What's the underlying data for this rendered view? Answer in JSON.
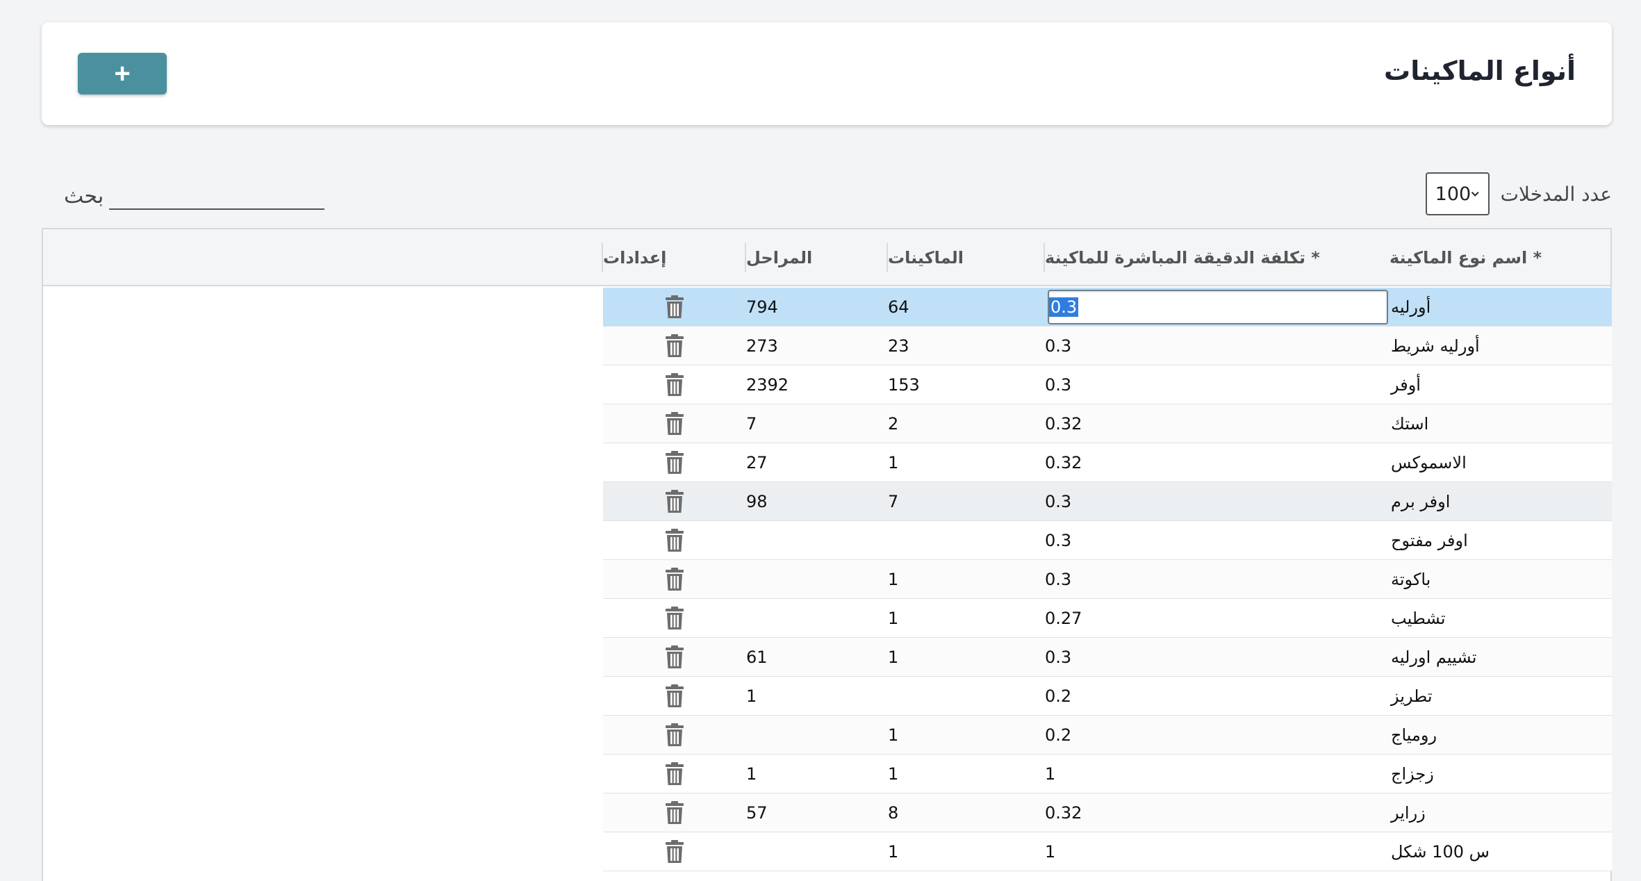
{
  "header": {
    "title": "أنواع الماكينات",
    "add_label": "+"
  },
  "controls": {
    "entries_label": "عدد المدخلات",
    "entries_value": "100",
    "search_label": "بحث",
    "search_value": ""
  },
  "table": {
    "columns": {
      "name": "* اسم نوع الماكينة",
      "cost": "* تكلفة الدقيقة المباشرة للماكينة",
      "machines": "الماكينات",
      "stages": "المراحل",
      "settings": "إعدادات"
    },
    "rows": [
      {
        "name": "أورليه",
        "cost": "0.3",
        "machines": "64",
        "stages": "794"
      },
      {
        "name": "أورليه شريط",
        "cost": "0.3",
        "machines": "23",
        "stages": "273"
      },
      {
        "name": "أوفر",
        "cost": "0.3",
        "machines": "153",
        "stages": "2392"
      },
      {
        "name": "استك",
        "cost": "0.32",
        "machines": "2",
        "stages": "7"
      },
      {
        "name": "الاسموكس",
        "cost": "0.32",
        "machines": "1",
        "stages": "27"
      },
      {
        "name": "اوفر برم",
        "cost": "0.3",
        "machines": "7",
        "stages": "98"
      },
      {
        "name": "اوفر مفتوح",
        "cost": "0.3",
        "machines": "",
        "stages": ""
      },
      {
        "name": "باكوتة",
        "cost": "0.3",
        "machines": "1",
        "stages": ""
      },
      {
        "name": "تشطيب",
        "cost": "0.27",
        "machines": "1",
        "stages": ""
      },
      {
        "name": "تشييم اورليه",
        "cost": "0.3",
        "machines": "1",
        "stages": "61"
      },
      {
        "name": "تطريز",
        "cost": "0.2",
        "machines": "",
        "stages": "1"
      },
      {
        "name": "رومياج",
        "cost": "0.2",
        "machines": "1",
        "stages": ""
      },
      {
        "name": "زجزاج",
        "cost": "1",
        "machines": "1",
        "stages": "1"
      },
      {
        "name": "زراير",
        "cost": "0.32",
        "machines": "8",
        "stages": "57"
      },
      {
        "name": "س 100 شكل",
        "cost": "1",
        "machines": "1",
        "stages": ""
      }
    ]
  },
  "colors": {
    "accent": "#4a909f",
    "selected_row": "#bfe0f7",
    "text_selection": "#2f7de0"
  }
}
